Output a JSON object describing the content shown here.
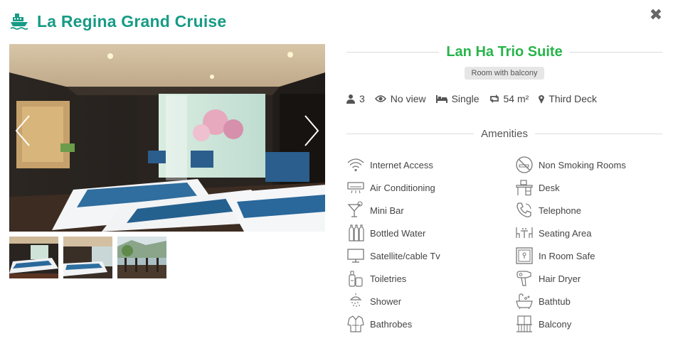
{
  "header": {
    "title": "La Regina Grand Cruise",
    "icon": "ship-icon"
  },
  "close": {
    "label": "✖",
    "icon": "close-icon"
  },
  "room": {
    "name": "Lan Ha Trio Suite",
    "badge": "Room with balcony",
    "specs": {
      "guests": "3",
      "view": "No view",
      "bed": "Single",
      "size": "54 m²",
      "deck": "Third Deck"
    }
  },
  "amenities_heading": "Amenities",
  "amenities": {
    "left": [
      {
        "label": "Internet Access",
        "icon": "wifi-icon"
      },
      {
        "label": "Air Conditioning",
        "icon": "air-conditioner-icon"
      },
      {
        "label": "Mini Bar",
        "icon": "cocktail-icon"
      },
      {
        "label": "Bottled Water",
        "icon": "bottles-icon"
      },
      {
        "label": "Satellite/cable Tv",
        "icon": "tv-icon"
      },
      {
        "label": "Toiletries",
        "icon": "toiletries-icon"
      },
      {
        "label": "Shower",
        "icon": "shower-icon"
      },
      {
        "label": "Bathrobes",
        "icon": "bathrobe-icon"
      }
    ],
    "right": [
      {
        "label": "Non Smoking Rooms",
        "icon": "no-smoking-icon"
      },
      {
        "label": "Desk",
        "icon": "desk-icon"
      },
      {
        "label": "Telephone",
        "icon": "telephone-icon"
      },
      {
        "label": "Seating Area",
        "icon": "seating-icon"
      },
      {
        "label": "In Room Safe",
        "icon": "safe-icon"
      },
      {
        "label": "Hair Dryer",
        "icon": "hair-dryer-icon"
      },
      {
        "label": "Bathtub",
        "icon": "bathtub-icon"
      },
      {
        "label": "Balcony",
        "icon": "balcony-icon"
      }
    ]
  },
  "colors": {
    "brand": "#179b86",
    "room_title": "#27b44a"
  }
}
